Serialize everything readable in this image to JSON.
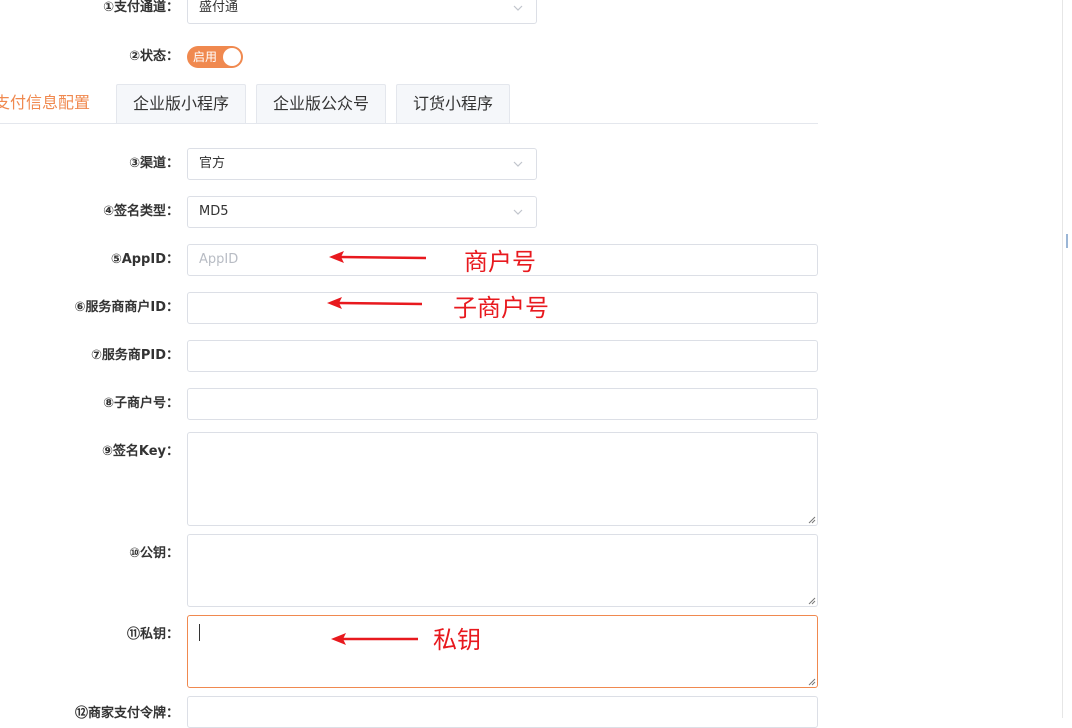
{
  "form": {
    "pay_channel": {
      "label": "①支付通道：",
      "value": "盛付通"
    },
    "status": {
      "label": "②状态：",
      "switch_text": "启用",
      "enabled": true
    },
    "channel": {
      "label": "③渠道：",
      "value": "官方"
    },
    "sign_type": {
      "label": "④签名类型：",
      "value": "MD5"
    },
    "appid": {
      "label": "⑤AppID：",
      "placeholder": "AppID",
      "value": ""
    },
    "sp_merchant_id": {
      "label": "⑥服务商商户ID：",
      "value": ""
    },
    "sp_pid": {
      "label": "⑦服务商PID：",
      "value": ""
    },
    "sub_merchant_no": {
      "label": "⑧子商户号：",
      "value": ""
    },
    "sign_key": {
      "label": "⑨签名Key：",
      "value": ""
    },
    "public_key": {
      "label": "⑩公钥：",
      "value": ""
    },
    "private_key": {
      "label": "⑪私钥：",
      "value": ""
    },
    "merchant_token": {
      "label": "⑫商家支付令牌："
    }
  },
  "tabs": [
    {
      "label": "支付信息配置",
      "active": true
    },
    {
      "label": "企业版小程序",
      "active": false
    },
    {
      "label": "企业版公众号",
      "active": false
    },
    {
      "label": "订货小程序",
      "active": false
    }
  ],
  "annotations": {
    "appid_note": "商户号",
    "sp_merchant_note": "子商户号",
    "private_key_note": "私钥"
  },
  "colors": {
    "accent": "#f0894f",
    "annotation_red": "#e8191e",
    "border": "#dcdfe6"
  }
}
